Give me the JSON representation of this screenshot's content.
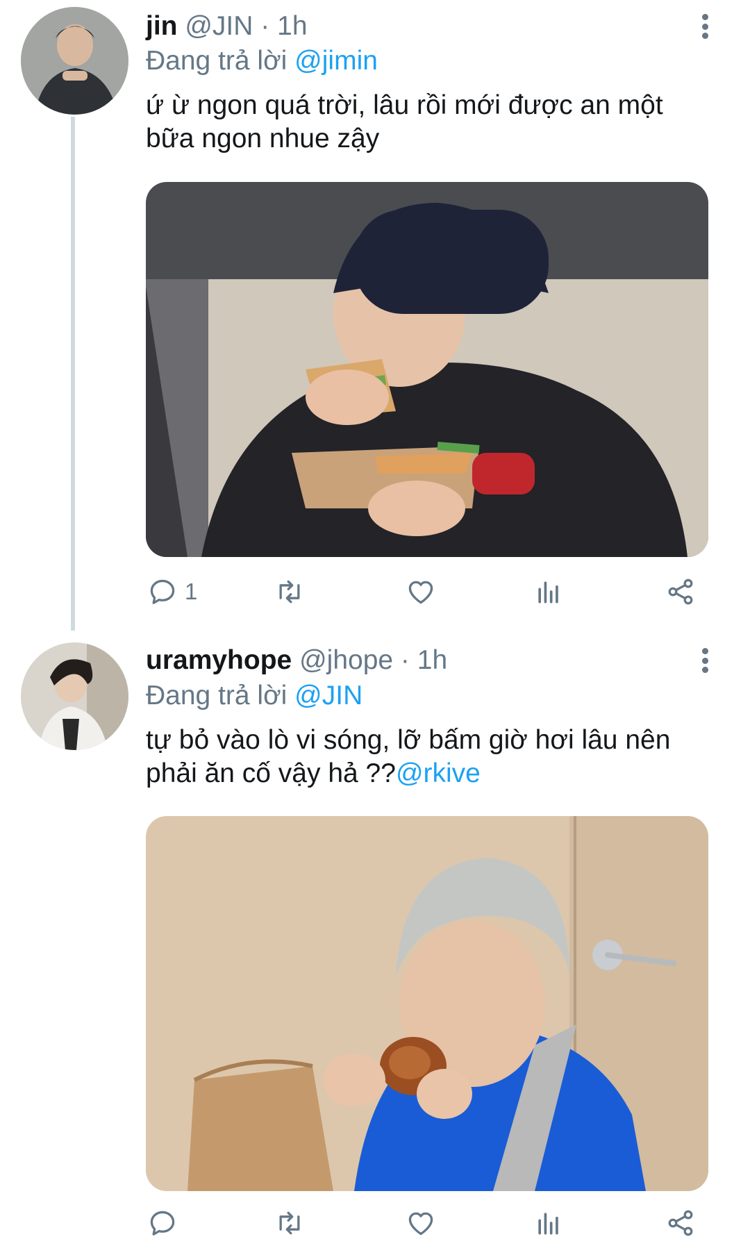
{
  "tweets": [
    {
      "name": "jin",
      "handle": "@JIN",
      "separator": "·",
      "time": "1h",
      "reply_prefix": "Đang trả lời",
      "reply_to": "@jimin",
      "text": "ứ ừ ngon quá trời, lâu rồi mới được an một bữa ngon nhue zậy",
      "text_mention": "",
      "reply_count": "1",
      "icons": [
        "reply-icon",
        "retweet-icon",
        "like-icon",
        "stats-icon",
        "share-icon"
      ]
    },
    {
      "name": "uramyhope",
      "handle": "@jhope",
      "separator": "·",
      "time": "1h",
      "reply_prefix": "Đang trả lời",
      "reply_to": "@JIN",
      "text": "tự bỏ vào lò vi sóng, lỡ bấm giờ hơi lâu nên phải ăn cố vậy hả ??",
      "text_mention": "@rkive",
      "reply_count": "",
      "icons": [
        "reply-icon",
        "retweet-icon",
        "like-icon",
        "stats-icon",
        "share-icon"
      ]
    }
  ],
  "colors": {
    "accent": "#1da1f2",
    "secondary_text": "#657786",
    "primary_text": "#14171a",
    "thread_line": "#cfd9de"
  }
}
